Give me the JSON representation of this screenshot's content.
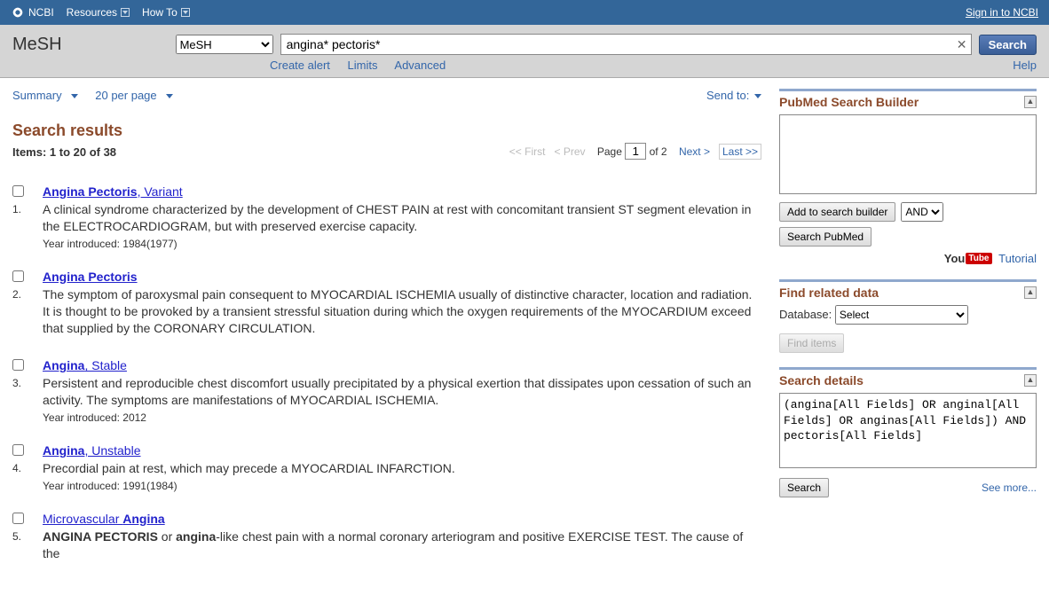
{
  "topbar": {
    "logo": "NCBI",
    "resources": "Resources",
    "howto": "How To",
    "signin": "Sign in to NCBI"
  },
  "search": {
    "brand": "MeSH",
    "db_selected": "MeSH",
    "query": "angina* pectoris*",
    "button": "Search",
    "create_alert": "Create alert",
    "limits": "Limits",
    "advanced": "Advanced",
    "help": "Help"
  },
  "toolbar": {
    "summary": "Summary",
    "perpage": "20 per page",
    "sendto": "Send to:"
  },
  "results": {
    "heading": "Search results",
    "count": "Items: 1 to 20 of 38",
    "pager": {
      "first": "<< First",
      "prev": "< Prev",
      "page_label": "Page",
      "page_value": "1",
      "of": "of 2",
      "next": "Next >",
      "last": "Last >>"
    },
    "items": [
      {
        "num": "1.",
        "title_html": "<b>Angina Pectoris</b>, Variant",
        "desc_html": "A clinical syndrome characterized by the development of CHEST PAIN at rest with concomitant transient ST segment elevation in the ELECTROCARDIOGRAM, but with preserved exercise capacity.",
        "year": "Year introduced: 1984(1977)"
      },
      {
        "num": "2.",
        "title_html": "<b>Angina Pectoris</b>",
        "desc_html": "The symptom of paroxysmal pain consequent to MYOCARDIAL ISCHEMIA usually of distinctive character, location and radiation. It is thought to be provoked by a transient stressful situation during which the oxygen requirements of the MYOCARDIUM exceed that supplied by the CORONARY CIRCULATION.",
        "year": ""
      },
      {
        "num": "3.",
        "title_html": "<b>Angina</b>, Stable",
        "desc_html": "Persistent and reproducible chest discomfort usually precipitated by a physical exertion that dissipates upon cessation of such an activity. The symptoms are manifestations of MYOCARDIAL ISCHEMIA.",
        "year": "Year introduced: 2012"
      },
      {
        "num": "4.",
        "title_html": "<b>Angina</b>, Unstable",
        "desc_html": "Precordial pain at rest, which may precede a MYOCARDIAL INFARCTION.",
        "year": "Year introduced: 1991(1984)"
      },
      {
        "num": "5.",
        "title_html": "Microvascular <b>Angina</b>",
        "desc_html": "<b>ANGINA PECTORIS</b> or <b>angina</b>-like chest pain with a normal coronary arteriogram and positive EXERCISE TEST. The cause of the",
        "year": ""
      }
    ]
  },
  "sidebar": {
    "builder": {
      "title": "PubMed Search Builder",
      "add": "Add to search builder",
      "op": "AND",
      "search_pubmed": "Search PubMed",
      "tutorial": "Tutorial"
    },
    "related": {
      "title": "Find related data",
      "db_label": "Database:",
      "db_value": "Select",
      "find": "Find items"
    },
    "details": {
      "title": "Search details",
      "text": "(angina[All Fields] OR anginal[All Fields] OR anginas[All Fields]) AND pectoris[All Fields]",
      "search": "Search",
      "seemore": "See more..."
    }
  }
}
